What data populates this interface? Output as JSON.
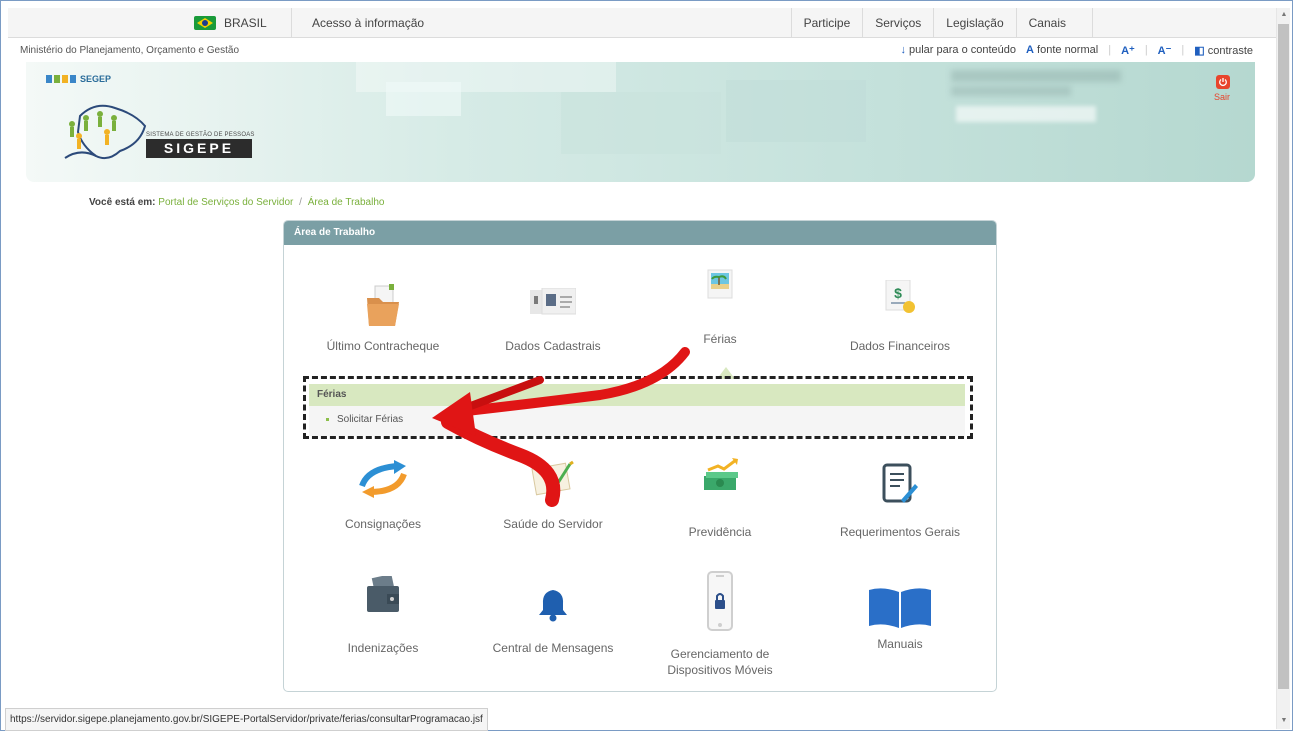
{
  "gov_bar": {
    "brasil": "BRASIL",
    "acesso": "Acesso à informação",
    "nav": [
      "Participe",
      "Serviços",
      "Legislação",
      "Canais"
    ]
  },
  "sec_bar": {
    "ministry": "Ministério do Planejamento, Orçamento e Gestão",
    "skip": "pular para o conteúdo",
    "font_normal": "fonte normal",
    "font_plus": "A⁺",
    "font_minus": "A⁻",
    "contrast": "contraste"
  },
  "header": {
    "segep": "SEGEP",
    "sistema": "SISTEMA DE GESTÃO DE PESSOAS",
    "sigepe": "SIGEPE",
    "logout": "Sair"
  },
  "breadcrumb": {
    "label": "Você está em:",
    "items": [
      "Portal de Serviços do Servidor",
      "Área de Trabalho"
    ]
  },
  "panel": {
    "title": "Área de Trabalho",
    "tiles": [
      "Último Contracheque",
      "Dados Cadastrais",
      "Férias",
      "Dados Financeiros",
      "Consignações",
      "Saúde do Servidor",
      "Previdência",
      "Requerimentos Gerais",
      "Indenizações",
      "Central de Mensagens",
      "Gerenciamento de Dispositivos Móveis",
      "Manuais"
    ]
  },
  "submenu": {
    "title": "Férias",
    "item": "Solicitar Férias"
  },
  "status_url": "https://servidor.sigepe.planejamento.gov.br/SIGEPE-PortalServidor/private/ferias/consultarProgramacao.jsf",
  "colors": {
    "accent_green": "#7ab03c",
    "panel_header": "#7b9fa5",
    "submenu_header": "#d8e8c0",
    "arrow_red": "#e01515"
  }
}
